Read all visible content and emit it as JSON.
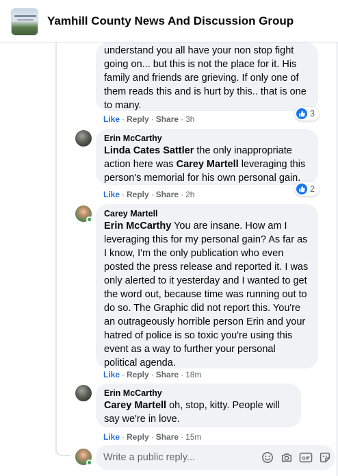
{
  "group": {
    "name": "Yamhill County News And Discussion Group",
    "thumb_icon": "group-cover-photo"
  },
  "comments": [
    {
      "author": "",
      "text": "understand you all have your non stop fight going on... but this is not the place for it. His family and friends are grieving. If only one of them reads this and is hurt by this.. that is one to many.",
      "actions": {
        "like": "Like",
        "reply": "Reply",
        "share": "Share",
        "time": "3h"
      },
      "reactions": {
        "icon": "like-icon",
        "count": "3"
      }
    },
    {
      "author": "Erin McCarthy",
      "mention": "Linda Cates Sattler",
      "text_a": " the only inappropriate action here was ",
      "mention2": "Carey Martell",
      "text_b": " leveraging this person's memorial for his own personal gain.",
      "actions": {
        "like": "Like",
        "reply": "Reply",
        "share": "Share",
        "time": "2h"
      },
      "reactions": {
        "icon": "like-icon",
        "count": "2"
      }
    },
    {
      "author": "Carey Martell",
      "mention": "Erin McCarthy",
      "text": " You are insane. How am I leveraging this for my personal gain? As far as I know, I'm the only publication who even posted the press release and reported it. I was only alerted to it yesterday and I wanted to get the word out, because time was running out to do so. The Graphic did not report this. You're an outrageously horrible person Erin and your hatred of police is so toxic you're using this event as a way to further your personal political agenda.",
      "actions": {
        "like": "Like",
        "reply": "Reply",
        "share": "Share",
        "time": "18m"
      }
    },
    {
      "author": "Erin McCarthy",
      "mention": "Carey Martell",
      "text": " oh, stop, kitty. People will say we're in love.",
      "actions": {
        "like": "Like",
        "reply": "Reply",
        "share": "Share",
        "time": "15m"
      }
    }
  ],
  "composer": {
    "placeholder": "Write a public reply...",
    "tools": [
      "emoji-icon",
      "camera-icon",
      "gif-icon",
      "sticker-icon"
    ]
  },
  "colors": {
    "like_blue": "#216fdb",
    "bubble_bg": "#f0f2f5",
    "meta_gray": "#65676b",
    "online_green": "#31a24c"
  }
}
